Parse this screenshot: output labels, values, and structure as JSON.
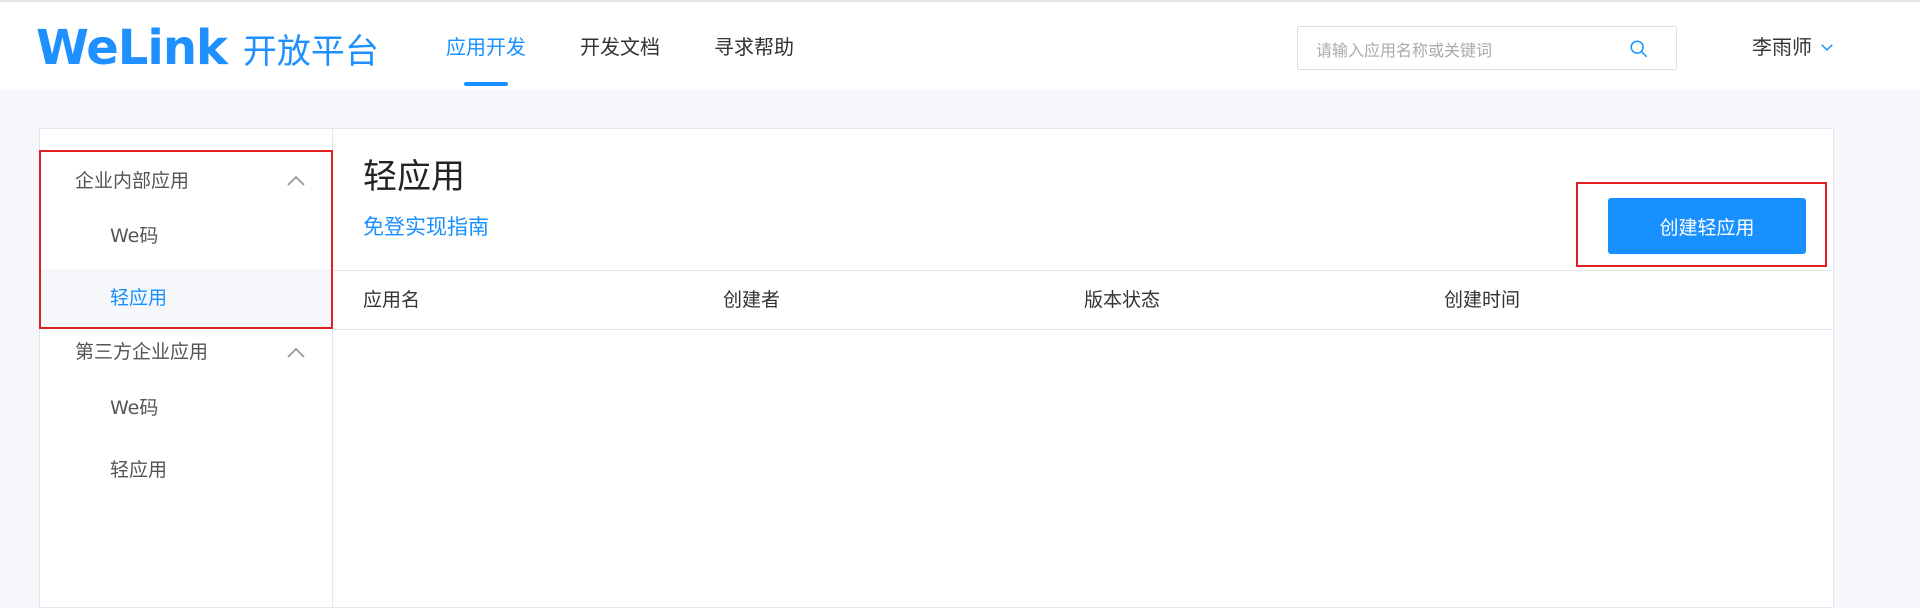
{
  "header": {
    "logo_word": "WeLink",
    "logo_sub": "开放平台",
    "nav": [
      {
        "label": "应用开发",
        "active": true
      },
      {
        "label": "开发文档",
        "active": false
      },
      {
        "label": "寻求帮助",
        "active": false
      }
    ],
    "search": {
      "placeholder": "请输入应用名称或关键词",
      "value": ""
    },
    "user_name": "李雨师"
  },
  "sidebar": {
    "groups": [
      {
        "title": "企业内部应用",
        "items": [
          {
            "label": "We码",
            "active": false
          },
          {
            "label": "轻应用",
            "active": true
          }
        ]
      },
      {
        "title": "第三方企业应用",
        "items": [
          {
            "label": "We码",
            "active": false
          },
          {
            "label": "轻应用",
            "active": false
          }
        ]
      }
    ]
  },
  "main": {
    "title": "轻应用",
    "guide_link": "免登实现指南",
    "create_button": "创建轻应用",
    "table": {
      "columns": [
        "应用名",
        "创建者",
        "版本状态",
        "创建时间"
      ],
      "rows": []
    }
  },
  "colors": {
    "accent": "#1890ff",
    "highlight_box": "#e02020"
  },
  "icons": {
    "search": "search-icon",
    "user_dropdown": "chevron-down-icon",
    "group_collapse": "chevron-up-icon"
  }
}
